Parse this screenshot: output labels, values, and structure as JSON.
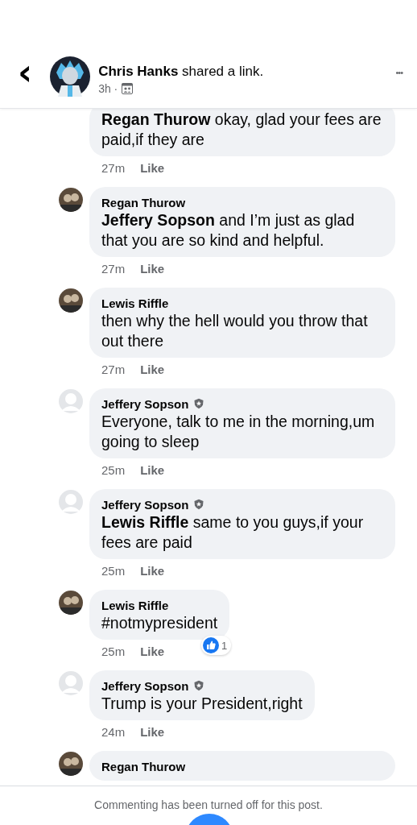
{
  "header": {
    "back": "‹",
    "author": "Chris Hanks",
    "action": "shared a link.",
    "meta": "3h ·",
    "menu": "•••"
  },
  "comments": [
    {
      "text": "**Regan Thurow** okay, glad your fees are paid,if they are",
      "time": "27m",
      "like": "Like"
    },
    {
      "author": "Regan Thurow",
      "verified": false,
      "photo": true,
      "text": "**Jeffery Sopson** and I’m just as glad that you are so kind and helpful.",
      "time": "27m",
      "like": "Like"
    },
    {
      "author": "Lewis Riffle",
      "verified": false,
      "photo": true,
      "text": "then why the hell would you throw that out there",
      "time": "27m",
      "like": "Like"
    },
    {
      "author": "Jeffery Sopson",
      "verified": true,
      "photo": false,
      "text": "Everyone, talk to me in the morning,um going to sleep",
      "time": "25m",
      "like": "Like"
    },
    {
      "author": "Jeffery Sopson",
      "verified": true,
      "photo": false,
      "text": "**Lewis Riffle** same to you guys,if your fees are paid",
      "time": "25m",
      "like": "Like"
    },
    {
      "author": "Lewis Riffle",
      "verified": false,
      "photo": true,
      "text": "#notmypresident",
      "time": "25m",
      "like": "Like",
      "reactions": "1"
    },
    {
      "author": "Jeffery Sopson",
      "verified": true,
      "photo": false,
      "text": "Trump is your President,right",
      "time": "24m",
      "like": "Like"
    },
    {
      "author": "Regan Thurow",
      "verified": false,
      "photo": true
    }
  ],
  "footer": {
    "notice": "Commenting has been turned off for this post."
  }
}
